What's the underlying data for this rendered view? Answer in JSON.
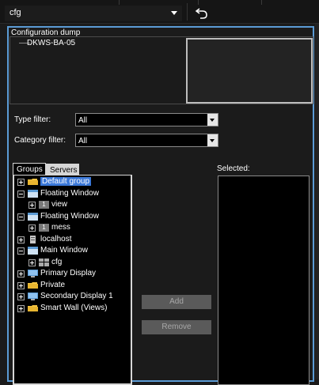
{
  "toolbar": {
    "config_select_value": "cfg"
  },
  "panel": {
    "title": "Configuration dump",
    "machine_name": "DKWS-BA-05"
  },
  "filters": {
    "type_label": "Type filter:",
    "type_value": "All",
    "category_label": "Category filter:",
    "category_value": "All"
  },
  "tabs": {
    "groups": "Groups",
    "servers": "Servers"
  },
  "tree": {
    "items": [
      {
        "label": "Default group",
        "icon": "folder-icon",
        "expander": "plus",
        "level": 0,
        "selected": true
      },
      {
        "label": "Floating Window",
        "icon": "window-icon",
        "expander": "minus",
        "level": 0
      },
      {
        "label": "view",
        "icon": "view-icon",
        "expander": "plus",
        "level": 1,
        "badge": "1"
      },
      {
        "label": "Floating Window",
        "icon": "window-icon",
        "expander": "minus",
        "level": 0
      },
      {
        "label": "mess",
        "icon": "view-icon",
        "expander": "plus",
        "level": 1,
        "badge": "1"
      },
      {
        "label": "localhost",
        "icon": "server-icon",
        "expander": "plus",
        "level": 0
      },
      {
        "label": "Main Window",
        "icon": "window-icon",
        "expander": "minus",
        "level": 0
      },
      {
        "label": "cfg",
        "icon": "grid-view-icon",
        "expander": "plus",
        "level": 1
      },
      {
        "label": "Primary Display",
        "icon": "monitor-icon",
        "expander": "plus",
        "level": 0
      },
      {
        "label": "Private",
        "icon": "folder-icon",
        "expander": "plus",
        "level": 0
      },
      {
        "label": "Secondary Display 1",
        "icon": "monitor-icon",
        "expander": "plus",
        "level": 0
      },
      {
        "label": "Smart Wall (Views)",
        "icon": "folder-icon",
        "expander": "plus",
        "level": 0
      }
    ]
  },
  "selected": {
    "label": "Selected:"
  },
  "actions": {
    "add": "Add",
    "remove": "Remove"
  },
  "colors": {
    "accent": "#5b9bd5",
    "selection": "#3b78d8",
    "folder": "#f4c542"
  }
}
